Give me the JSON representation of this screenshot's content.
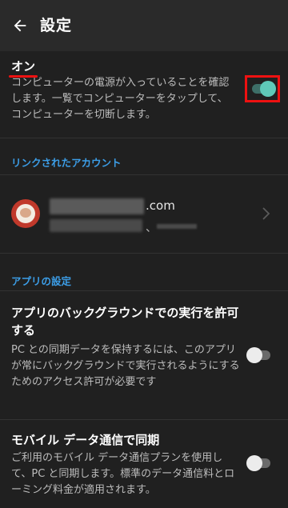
{
  "appbar": {
    "title": "設定"
  },
  "on_setting": {
    "title": "オン",
    "description": "コンピューターの電源が入っていることを確認します。一覧でコンピューターをタップして、コンピューターを切断します。",
    "toggle_state": "on"
  },
  "linked_accounts": {
    "header": "リンクされたアカウント",
    "account": {
      "email_domain": ".com",
      "sub_text": "、"
    }
  },
  "app_settings": {
    "header": "アプリの設定",
    "items": [
      {
        "title": "アプリのバックグラウンドでの実行を許可する",
        "description": "PC との同期データを保持するには、このアプリが常にバックグラウンドで実行されるようにするためのアクセス許可が必要です",
        "toggle_state": "off"
      },
      {
        "title": "モバイル データ通信で同期",
        "description": "ご利用のモバイル データ通信プランを使用して、PC と同期します。標準のデータ通信料とローミング料金が適用されます。",
        "toggle_state": "off"
      }
    ]
  },
  "colors": {
    "background": "#202020",
    "appbar": "#2a2a2a",
    "accent_blue": "#3c9ee8",
    "toggle_on_track": "#3d6f68",
    "toggle_on_knob": "#5fc9b8",
    "highlight_red": "#ee1111"
  }
}
